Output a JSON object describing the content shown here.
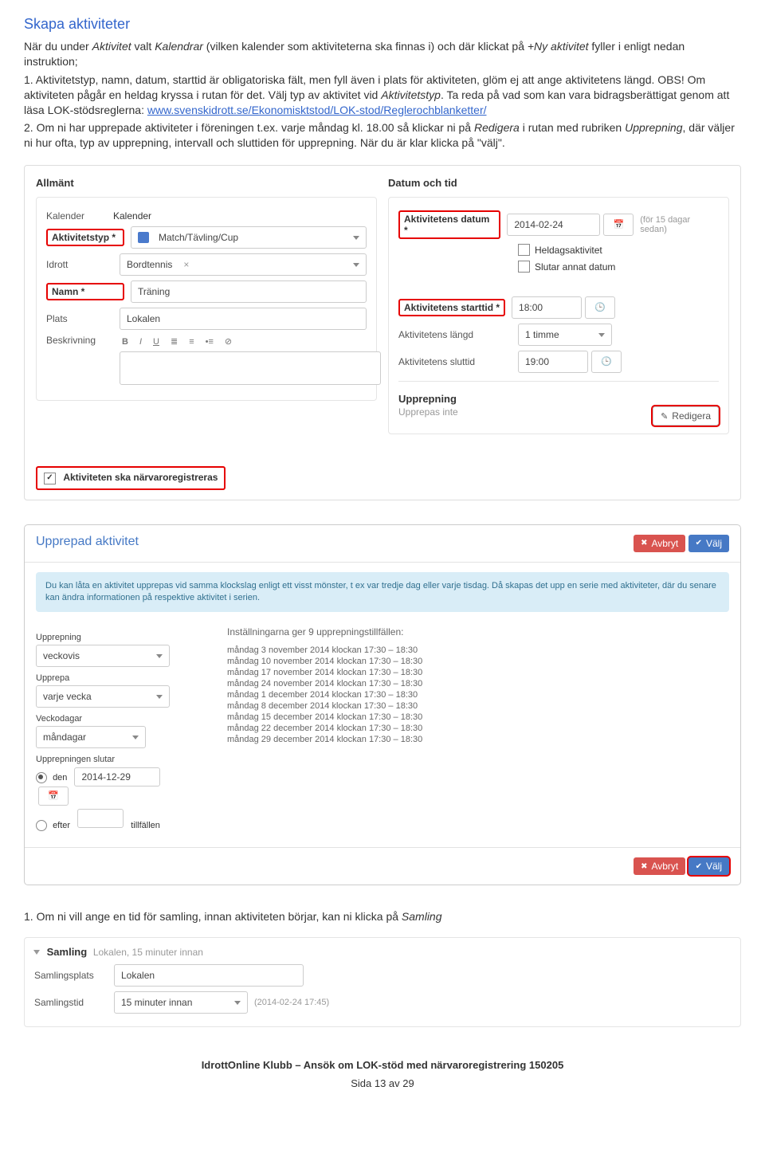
{
  "title": "Skapa aktiviteter",
  "intro": {
    "p1a": "När du under ",
    "p1b": "Aktivitet",
    "p1c": " valt ",
    "p1d": "Kalendrar",
    "p1e": " (vilken kalender som aktiviteterna ska finnas i) och där klickat på ",
    "p1f": "+Ny aktivitet",
    "p1g": " fyller i enligt nedan instruktion;",
    "li1": "1. Aktivitetstyp, namn, datum, starttid är obligatoriska fält, men fyll även i plats för aktiviteten, glöm ej att ange aktivitetens längd. OBS! Om aktiviteten pågår en heldag kryssa i rutan för det. Välj typ av aktivitet vid ",
    "li1b": "Aktivitetstyp",
    "li1c": ". Ta reda på vad som kan vara bidragsberättigat genom att läsa LOK-stödsreglerna: ",
    "link": "www.svenskidrott.se/Ekonomisktstod/LOK-stod/Reglerochblanketter/",
    "li2": "2. Om ni har upprepade aktiviteter i föreningen t.ex. varje måndag kl. 18.00 så klickar ni på ",
    "li2b": "Redigera",
    "li2c": " i rutan med rubriken ",
    "li2d": "Upprepning",
    "li2e": ", där väljer ni hur ofta, typ av upprepning, intervall och sluttiden för upprepning. När du är klar klicka på \"välj\"."
  },
  "form": {
    "allmant": "Allmänt",
    "datumtid": "Datum och tid",
    "rows": {
      "kalender": {
        "lbl": "Kalender",
        "val": "Kalender"
      },
      "aktivitetstyp": {
        "lbl": "Aktivitetstyp *",
        "val": "Match/Tävling/Cup"
      },
      "idrott": {
        "lbl": "Idrott",
        "val": "Bordtennis",
        "clear": "×"
      },
      "namn": {
        "lbl": "Namn *",
        "val": "Träning"
      },
      "plats": {
        "lbl": "Plats",
        "val": "Lokalen"
      },
      "beskrivning": {
        "lbl": "Beskrivning"
      }
    },
    "right": {
      "datum": {
        "lbl": "Aktivitetens datum *",
        "val": "2014-02-24",
        "note": "(för 15 dagar sedan)"
      },
      "heldag": "Heldagsaktivitet",
      "slutar": "Slutar annat datum",
      "starttid": {
        "lbl": "Aktivitetens starttid *",
        "val": "18:00"
      },
      "langd": {
        "lbl": "Aktivitetens längd",
        "val": "1 timme"
      },
      "sluttid": {
        "lbl": "Aktivitetens sluttid",
        "val": "19:00"
      },
      "upprep_head": "Upprepning",
      "upprep_sub": "Upprepas inte",
      "redigera": "Redigera"
    },
    "narvaro": "Aktiviteten ska närvaroregistreras"
  },
  "modal": {
    "title": "Upprepad aktivitet",
    "avbryt": "Avbryt",
    "valj": "Välj",
    "info": "Du kan låta en aktivitet upprepas vid samma klockslag enligt ett visst mönster, t ex var tredje dag eller varje tisdag. Då skapas det upp en serie med aktiviteter, där du senare kan ändra informationen på respektive aktivitet i serien.",
    "left": {
      "upprepning": {
        "lbl": "Upprepning",
        "val": "veckovis"
      },
      "upprepa": {
        "lbl": "Upprepa",
        "val": "varje vecka"
      },
      "veckodagar": {
        "lbl": "Veckodagar",
        "val": "måndagar"
      },
      "slutar": {
        "lbl": "Upprepningen slutar",
        "den": "den",
        "date": "2014-12-29",
        "efter": "efter",
        "tillf": "tillfällen"
      }
    },
    "right": {
      "hdr": "Inställningarna ger 9 upprepningstillfällen:",
      "lines": [
        "måndag 3 november 2014 klockan 17:30 – 18:30",
        "måndag 10 november 2014 klockan 17:30 – 18:30",
        "måndag 17 november 2014 klockan 17:30 – 18:30",
        "måndag 24 november 2014 klockan 17:30 – 18:30",
        "måndag 1 december 2014 klockan 17:30 – 18:30",
        "måndag 8 december 2014 klockan 17:30 – 18:30",
        "måndag 15 december 2014 klockan 17:30 – 18:30",
        "måndag 22 december 2014 klockan 17:30 – 18:30",
        "måndag 29 december 2014 klockan 17:30 – 18:30"
      ]
    }
  },
  "after_modal": {
    "li": "1.  Om ni vill ange en tid för samling, innan aktiviteten börjar, kan ni klicka på ",
    "em": "Samling"
  },
  "samling": {
    "head": "Samling",
    "sub": "Lokalen, 15 minuter innan",
    "plats": {
      "lbl": "Samlingsplats",
      "val": "Lokalen"
    },
    "tid": {
      "lbl": "Samlingstid",
      "val": "15 minuter innan",
      "note": "(2014-02-24 17:45)"
    }
  },
  "footer": "IdrottOnline Klubb – Ansök om LOK-stöd med närvaroregistrering 150205",
  "page": "Sida 13 av 29"
}
